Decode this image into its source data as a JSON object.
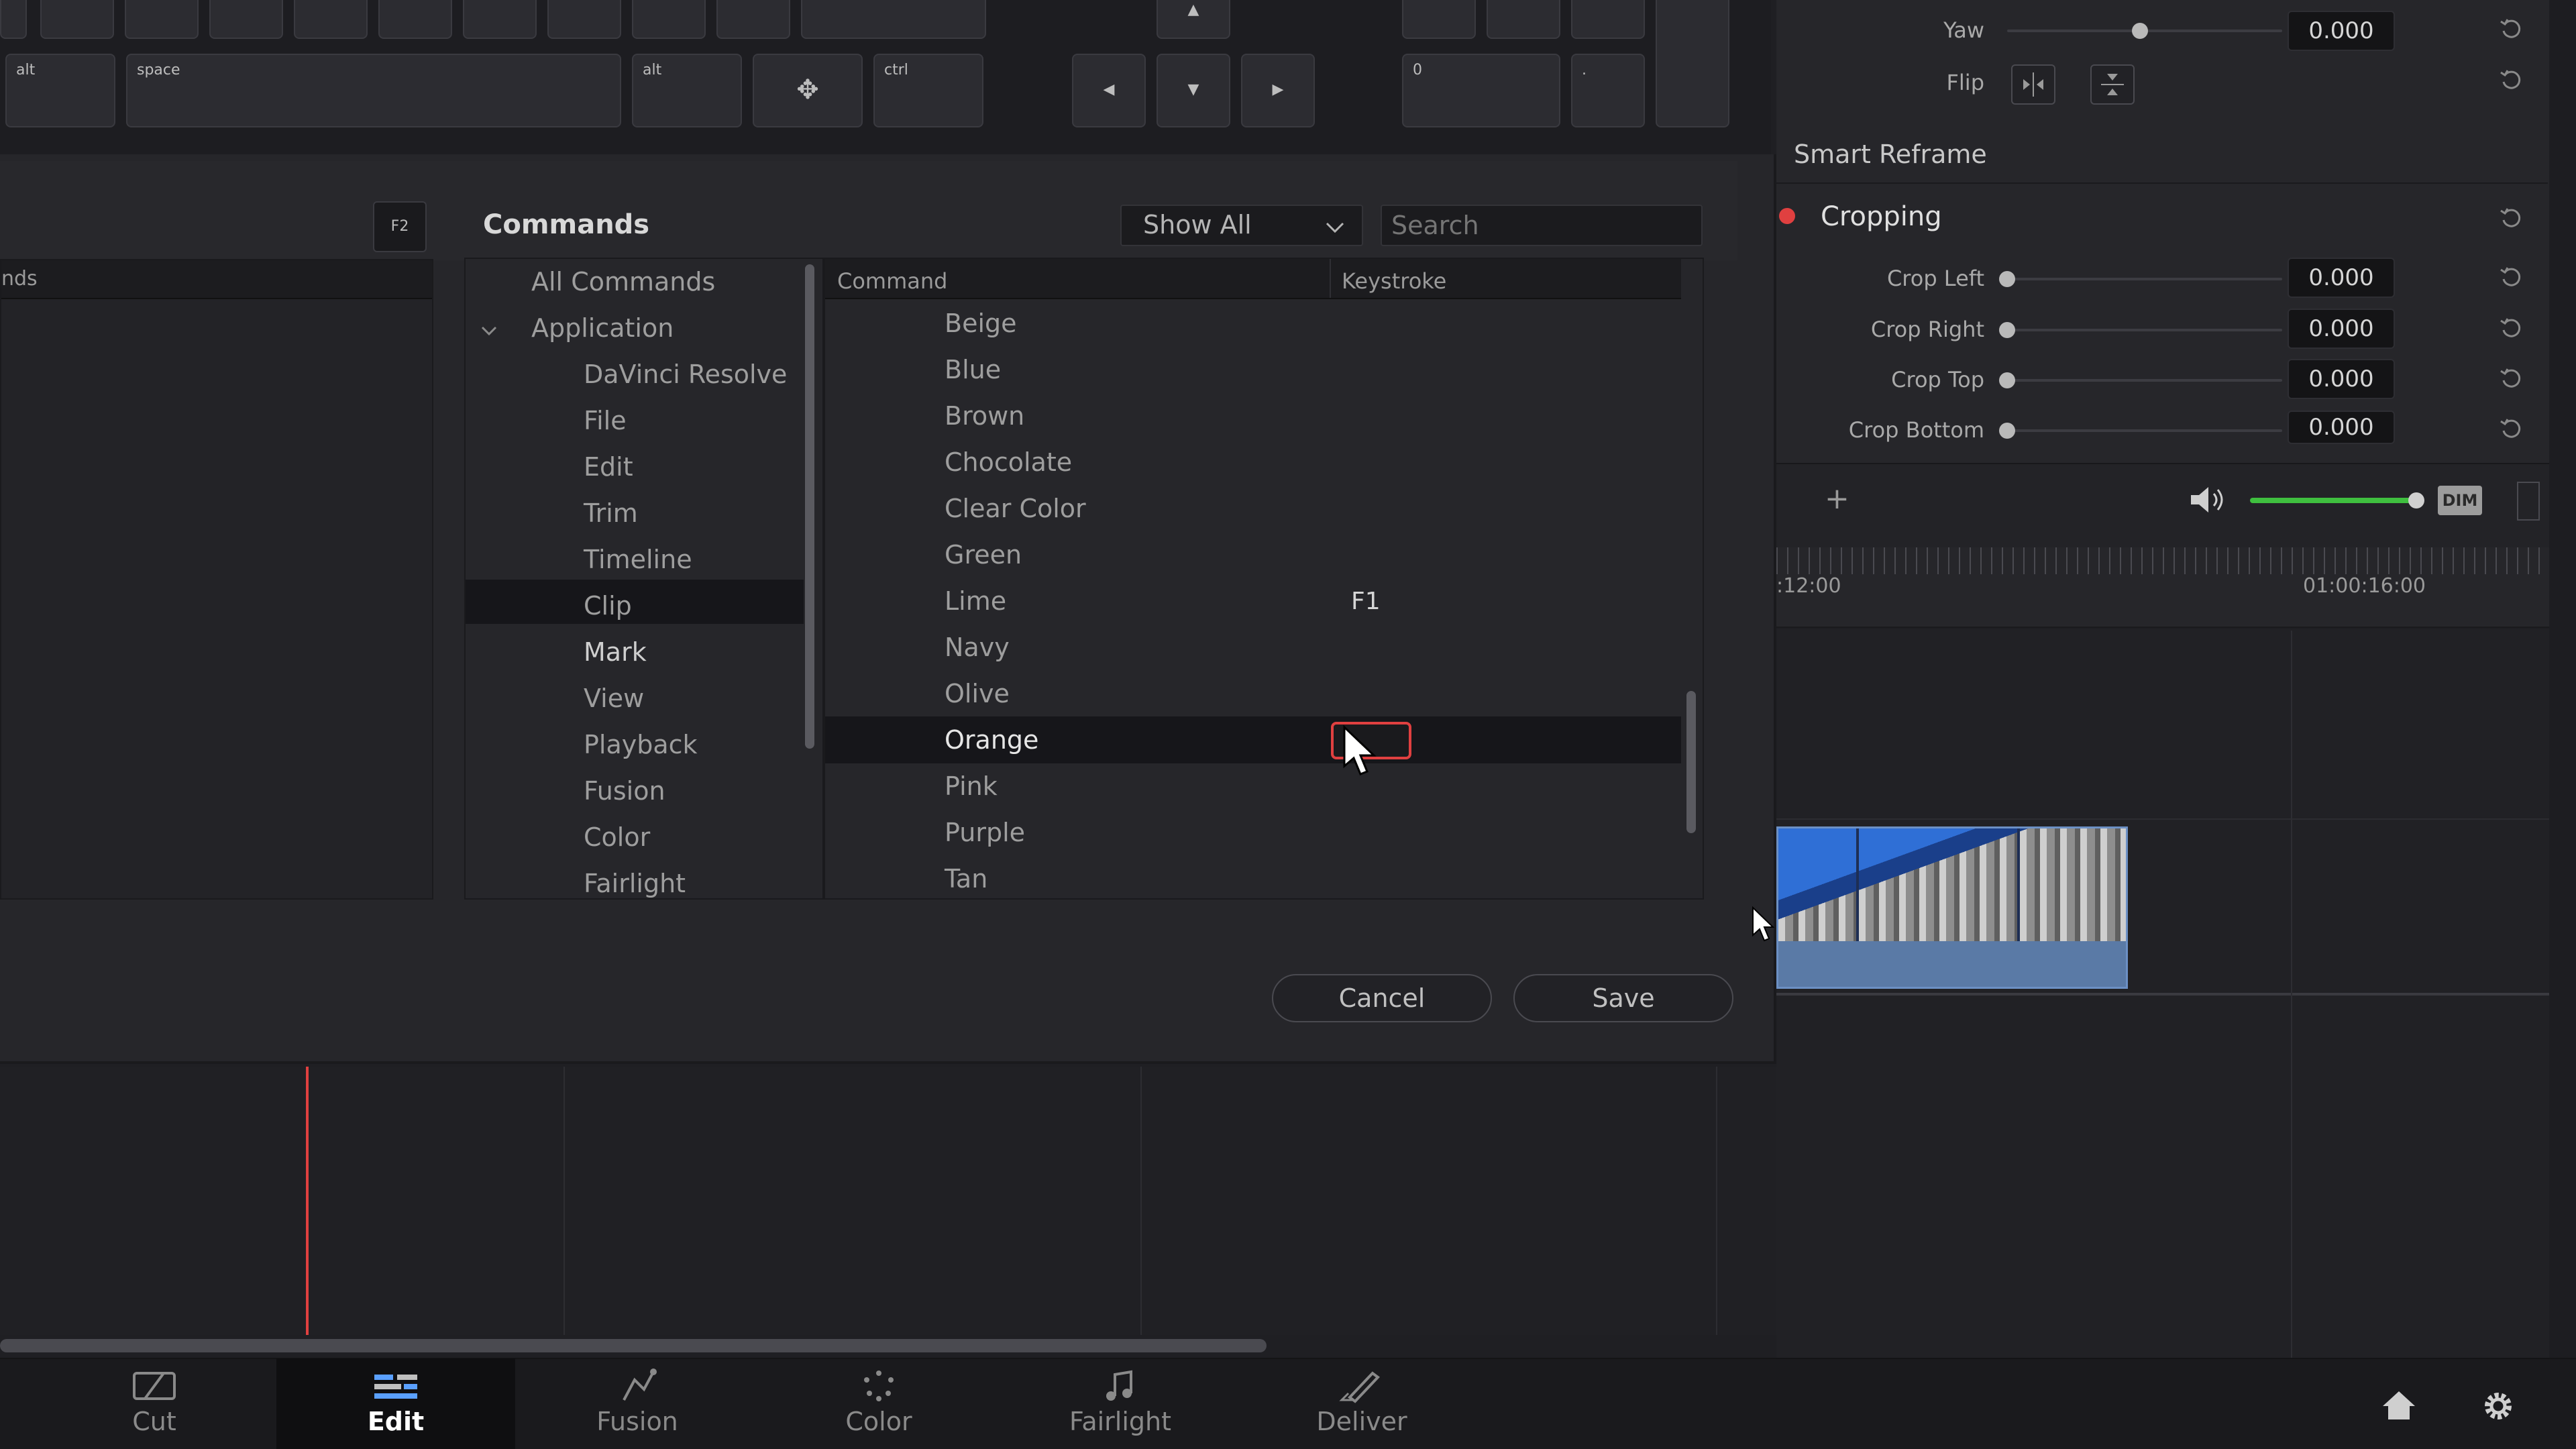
{
  "keyboard": {
    "keys": {
      "alt_left": "alt",
      "space": "space",
      "alt_right": "alt",
      "ctrl": "ctrl",
      "numpad_zero": "0",
      "numpad_dot": "."
    },
    "arrow_left": "◀",
    "arrow_down": "▼",
    "arrow_right": "▶",
    "arrow_up": "▲"
  },
  "keyboard_panel": {
    "shortcut_badge": "F2",
    "column_header_partial": "nds"
  },
  "commands": {
    "title": "Commands",
    "filter_selected": "Show All",
    "search_placeholder": "Search",
    "tree": [
      "All Commands",
      "Application",
      "DaVinci Resolve",
      "File",
      "Edit",
      "Trim",
      "Timeline",
      "Clip",
      "Mark",
      "View",
      "Playback",
      "Fusion",
      "Color",
      "Fairlight"
    ],
    "table_headers": {
      "command": "Command",
      "keystroke": "Keystroke"
    },
    "rows": [
      {
        "name": "Beige",
        "key": ""
      },
      {
        "name": "Blue",
        "key": ""
      },
      {
        "name": "Brown",
        "key": ""
      },
      {
        "name": "Chocolate",
        "key": ""
      },
      {
        "name": "Clear Color",
        "key": ""
      },
      {
        "name": "Green",
        "key": ""
      },
      {
        "name": "Lime",
        "key": "F1"
      },
      {
        "name": "Navy",
        "key": ""
      },
      {
        "name": "Olive",
        "key": ""
      },
      {
        "name": "Orange",
        "key": ""
      },
      {
        "name": "Pink",
        "key": ""
      },
      {
        "name": "Purple",
        "key": ""
      },
      {
        "name": "Tan",
        "key": ""
      }
    ],
    "selected_tree_item": "Mark",
    "selected_row": "Orange"
  },
  "dialog_buttons": {
    "cancel": "Cancel",
    "save": "Save"
  },
  "inspector": {
    "yaw_label": "Yaw",
    "yaw_value": "0.000",
    "flip_label": "Flip",
    "smart_reframe": "Smart Reframe",
    "cropping": "Cropping",
    "crop_left_label": "Crop Left",
    "crop_left_value": "0.000",
    "crop_right_label": "Crop Right",
    "crop_right_value": "0.000",
    "crop_top_label": "Crop Top",
    "crop_top_value": "0.000",
    "crop_bottom_label": "Crop Bottom",
    "crop_bottom_value": "0.000"
  },
  "viewer_controls": {
    "dim": "DIM",
    "plus": "+"
  },
  "timeline": {
    "tc_left": ":12:00",
    "tc_right": "01:00:16:00"
  },
  "pages": [
    {
      "name": "Cut",
      "icon": "cut-page-icon"
    },
    {
      "name": "Edit",
      "icon": "edit-page-icon"
    },
    {
      "name": "Fusion",
      "icon": "fusion-page-icon"
    },
    {
      "name": "Color",
      "icon": "color-page-icon"
    },
    {
      "name": "Fairlight",
      "icon": "fairlight-page-icon"
    },
    {
      "name": "Deliver",
      "icon": "deliver-page-icon"
    }
  ],
  "colors": {
    "accent_red": "#e04040",
    "volume_green": "#3fbf3f",
    "selection": "#16161a"
  }
}
